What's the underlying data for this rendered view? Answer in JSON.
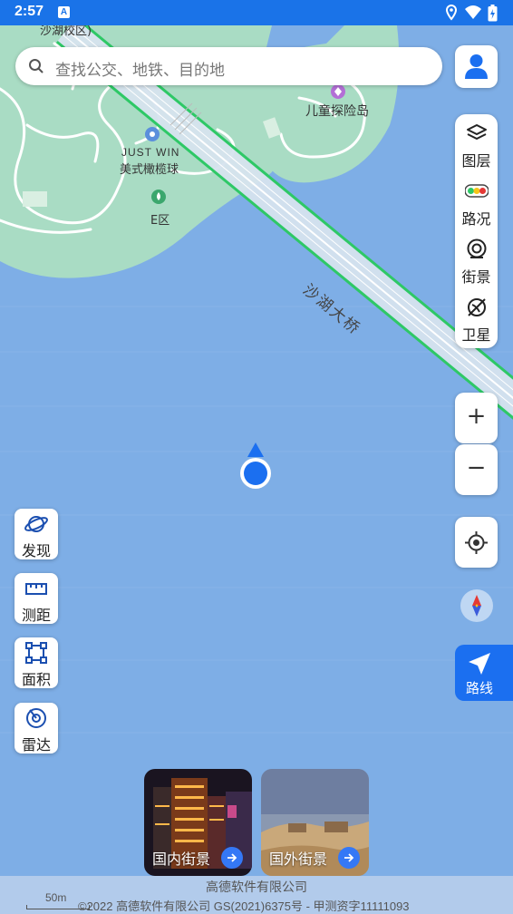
{
  "status_bar": {
    "time": "2:57",
    "notif_glyph": "A",
    "icons": [
      "location-icon",
      "wifi-icon",
      "battery-charging-icon"
    ]
  },
  "search": {
    "placeholder": "查找公交、地铁、目的地"
  },
  "map_labels": {
    "district_top": "沙湖校区)",
    "poi_kids": "儿童探险岛",
    "poi_rugby_en": "JUST WIN",
    "poi_rugby_cn": "美式橄榄球",
    "poi_zone_e": "E区",
    "bridge": "沙湖大桥"
  },
  "right_panel": [
    {
      "label": "图层",
      "icon": "layers-icon"
    },
    {
      "label": "路况",
      "icon": "traffic-light-icon"
    },
    {
      "label": "街景",
      "icon": "street-view-icon"
    },
    {
      "label": "卫星",
      "icon": "satellite-icon"
    }
  ],
  "zoom": {
    "in": "+",
    "out": "−"
  },
  "route": {
    "label": "路线"
  },
  "left_tools": [
    {
      "label": "发现",
      "icon": "planet-icon"
    },
    {
      "label": "测距",
      "icon": "ruler-icon"
    },
    {
      "label": "面积",
      "icon": "area-icon"
    },
    {
      "label": "雷达",
      "icon": "radar-icon"
    }
  ],
  "street_view_cards": [
    {
      "label": "国内街景"
    },
    {
      "label": "国外街景"
    }
  ],
  "footer": {
    "company": "高德软件有限公司",
    "copyright": "©2022 高德软件有限公司 GS(2021)6375号 - 甲测资字11111093",
    "scale": "50m"
  },
  "colors": {
    "accent": "#1b6ff0",
    "water": "#7eaee6",
    "land": "#a9dcc4",
    "road_edge": "#2ec866"
  }
}
